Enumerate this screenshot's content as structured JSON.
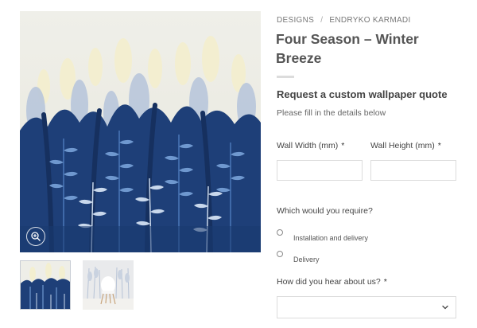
{
  "breadcrumb": {
    "items": [
      "DESIGNS",
      "ENDRYKO KARMADI"
    ],
    "separator": "/"
  },
  "product": {
    "title": "Four Season – Winter Breeze"
  },
  "quote": {
    "heading": "Request a custom wallpaper quote",
    "subtext": "Please fill in the details below"
  },
  "form": {
    "wall_width_label": "Wall Width (mm)",
    "wall_height_label": "Wall Height (mm)",
    "required_marker": "*",
    "require_question": "Which would you require?",
    "options": [
      "Installation and delivery",
      "Delivery"
    ],
    "hear_label": "How did you hear about us?",
    "hear_selected": ""
  },
  "colors": {
    "accent_navy": "#1e3f78",
    "background_cream": "#efede4",
    "text_dark": "#555555"
  },
  "icons": {
    "zoom": "zoom-in-icon",
    "select": "chevron-down-icon"
  }
}
